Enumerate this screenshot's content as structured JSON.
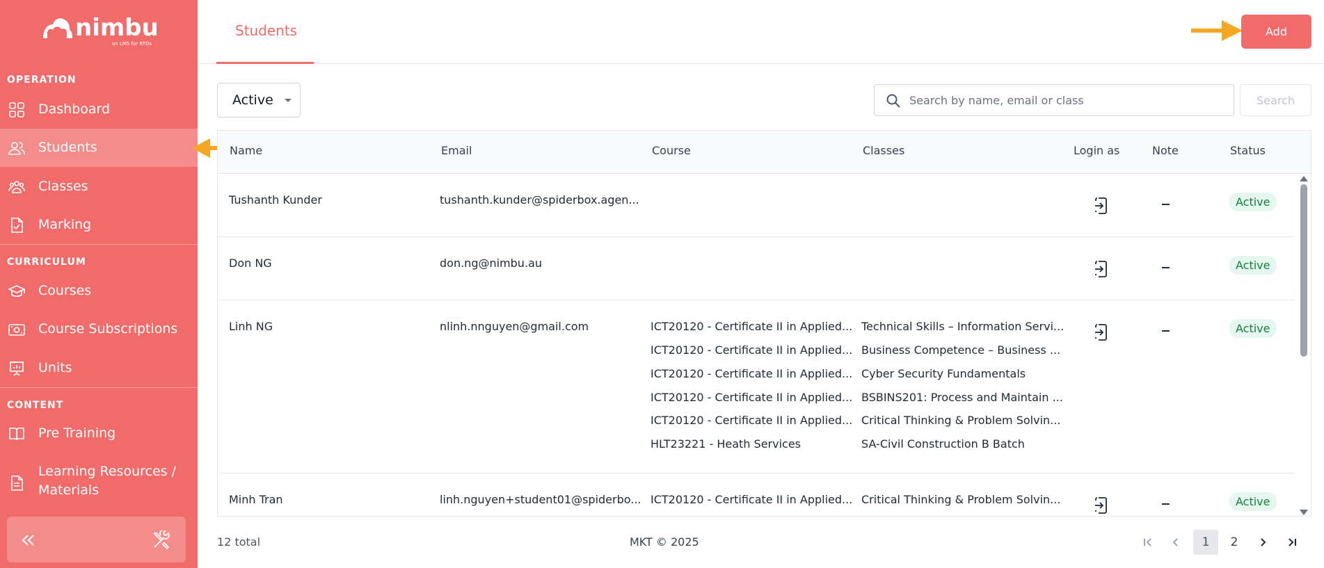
{
  "app": {
    "logo_text": "nimbu",
    "logo_tagline": "an LMS for RTOs"
  },
  "sidebar": {
    "sections": [
      {
        "label": "OPERATION"
      },
      {
        "label": "CURRICULUM"
      },
      {
        "label": "CONTENT"
      }
    ],
    "items": [
      {
        "label": "Dashboard",
        "icon": "dashboard-icon"
      },
      {
        "label": "Students",
        "icon": "users-icon",
        "active": true
      },
      {
        "label": "Classes",
        "icon": "group-icon"
      },
      {
        "label": "Marking",
        "icon": "checklist-icon"
      },
      {
        "label": "Courses",
        "icon": "graduation-cap-icon"
      },
      {
        "label": "Course Subscriptions",
        "icon": "subscription-card-icon"
      },
      {
        "label": "Units",
        "icon": "presentation-board-icon"
      },
      {
        "label": "Pre Training",
        "icon": "book-icon"
      },
      {
        "label": "Learning Resources / Materials",
        "icon": "document-icon"
      }
    ],
    "footer": {
      "collapse_icon": "double-chevron-left-icon",
      "tools_icon": "tools-icon"
    }
  },
  "header": {
    "tab_label": "Students",
    "add_label": "Add"
  },
  "filters": {
    "status_value": "Active",
    "search_placeholder": "Search by name, email or class",
    "search_label": "Search"
  },
  "table": {
    "columns": [
      "Name",
      "Email",
      "Course",
      "Classes",
      "Login as",
      "Note",
      "Status"
    ],
    "rows": [
      {
        "name": "Tushanth Kunder",
        "email": "tushanth.kunder@spiderbox.agen...",
        "courses": [],
        "classes": [],
        "note": "–",
        "status": "Active"
      },
      {
        "name": "Don NG",
        "email": "don.ng@nimbu.au",
        "courses": [],
        "classes": [],
        "note": "–",
        "status": "Active"
      },
      {
        "name": "Linh NG",
        "email": "nlinh.nnguyen@gmail.com",
        "courses": [
          "ICT20120 - Certificate II in Applied...",
          "ICT20120 - Certificate II in Applied...",
          "ICT20120 - Certificate II in Applied...",
          "ICT20120 - Certificate II in Applied...",
          "ICT20120 - Certificate II in Applied...",
          "HLT23221 - Heath Services"
        ],
        "classes": [
          "Technical Skills – Information Servi...",
          "Business Competence – Business ...",
          "Cyber Security Fundamentals",
          "BSBINS201: Process and Maintain ...",
          "Critical Thinking & Problem Solvin...",
          "SA-Civil Construction B Batch"
        ],
        "note": "–",
        "status": "Active"
      },
      {
        "name": "Minh Tran",
        "email": "linh.nguyen+student01@spiderbo...",
        "courses": [
          "ICT20120 - Certificate II in Applied..."
        ],
        "classes": [
          "Critical Thinking & Problem Solvin..."
        ],
        "note": "–",
        "status": "Active"
      }
    ]
  },
  "footer": {
    "total": "12 total",
    "copyright": "MKT © 2025",
    "pages": [
      "1",
      "2"
    ],
    "current_page": "1"
  },
  "colors": {
    "brand": "#f26b6b",
    "active_badge_bg": "#e6f7ef",
    "active_badge_text": "#15803d",
    "annotation_arrow": "#f5a623"
  }
}
